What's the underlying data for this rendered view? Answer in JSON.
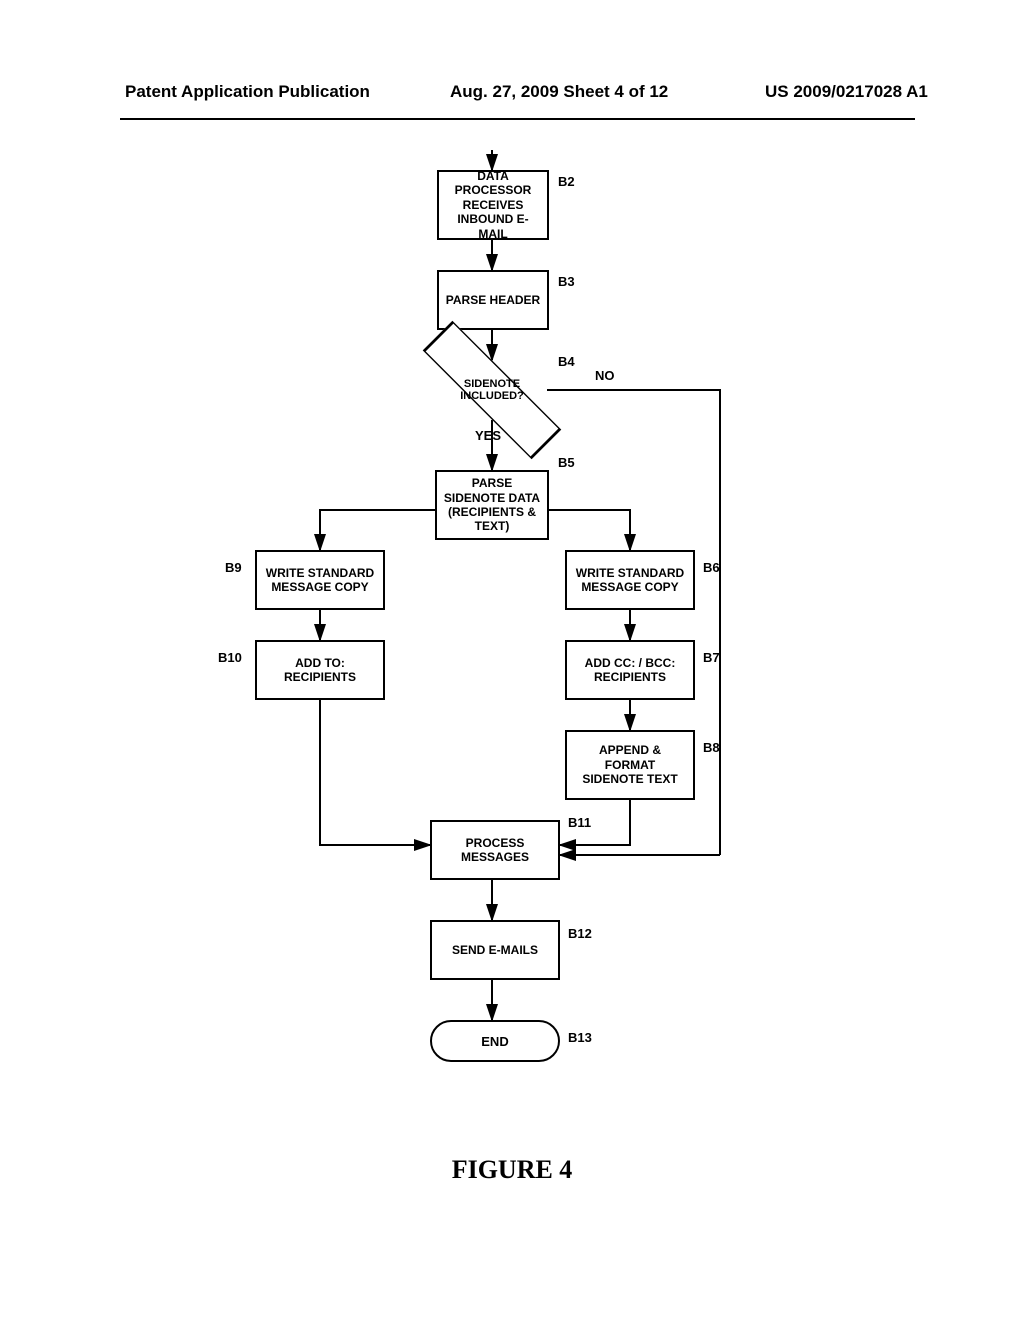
{
  "header": {
    "left": "Patent Application Publication",
    "center": "Aug. 27, 2009  Sheet 4 of 12",
    "right": "US 2009/0217028 A1"
  },
  "figure_caption": "FIGURE 4",
  "flow": {
    "b2": {
      "id": "B2",
      "text": "DATA PROCESSOR RECEIVES INBOUND E-MAIL"
    },
    "b3": {
      "id": "B3",
      "text": "PARSE HEADER"
    },
    "b4": {
      "id": "B4",
      "text": "SIDENOTE INCLUDED?",
      "yes": "YES",
      "no": "NO"
    },
    "b5": {
      "id": "B5",
      "text": "PARSE SIDENOTE DATA (RECIPIENTS & TEXT)"
    },
    "b6": {
      "id": "B6",
      "text": "WRITE STANDARD MESSAGE COPY"
    },
    "b7": {
      "id": "B7",
      "text": "ADD CC: / BCC: RECIPIENTS"
    },
    "b8": {
      "id": "B8",
      "text": "APPEND & FORMAT SIDENOTE TEXT"
    },
    "b9": {
      "id": "B9",
      "text": "WRITE STANDARD MESSAGE COPY"
    },
    "b10": {
      "id": "B10",
      "text": "ADD TO: RECIPIENTS"
    },
    "b11": {
      "id": "B11",
      "text": "PROCESS MESSAGES"
    },
    "b12": {
      "id": "B12",
      "text": "SEND E-MAILS"
    },
    "b13": {
      "id": "B13",
      "text": "END"
    }
  }
}
